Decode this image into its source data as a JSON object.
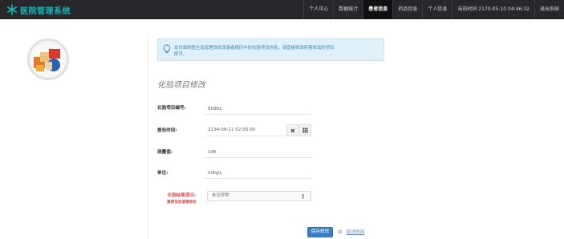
{
  "app": {
    "title": "医院管理系统",
    "brand_color": "#17b7b7"
  },
  "nav": {
    "items": [
      {
        "label": "个人中心",
        "active": false
      },
      {
        "label": "数据统计",
        "active": false
      },
      {
        "label": "患者信息",
        "active": true
      },
      {
        "label": "药品信息",
        "active": false
      },
      {
        "label": "个人信息",
        "active": false
      },
      {
        "label": "当前时间 2170-05-10 04:46:32",
        "active": false
      },
      {
        "label": "退出系统",
        "active": false
      }
    ]
  },
  "info": {
    "text": "本页面供医生及管理员修改患者病历中的化验项目信息，请直接修改所需修改的项目即可。",
    "icon": "lightbulb-icon"
  },
  "form": {
    "title": "化验项目修改",
    "item_id": {
      "label": "化验项目编号:",
      "value": "50902"
    },
    "report_time": {
      "label": "报告时间:",
      "value": "2134-09-11 02:05:00"
    },
    "measured_value": {
      "label": "测量值:",
      "value": "196"
    },
    "unit": {
      "label": "单位:",
      "value": "mEq/L"
    },
    "result_hint": {
      "label": "化验结果提示:",
      "sub_label": "重要信息谨慎修改",
      "selected": "未见异常"
    }
  },
  "actions": {
    "save_label": "保存修改",
    "or_text": "或",
    "cancel_label": "取消修改"
  }
}
